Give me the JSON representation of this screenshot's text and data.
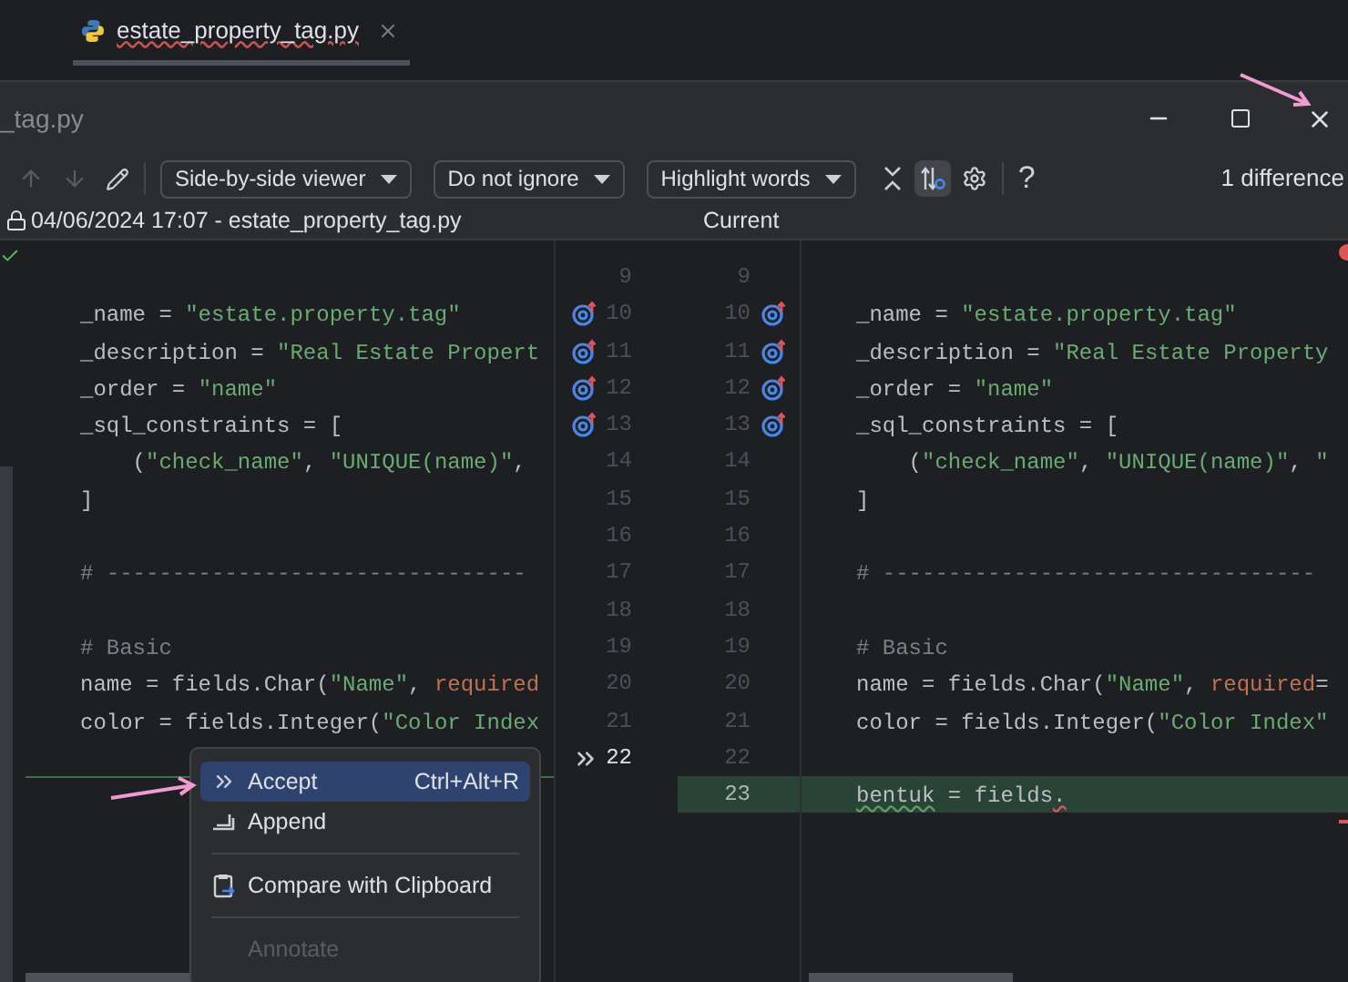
{
  "editor_tab": {
    "title": "estate_property_tag.py"
  },
  "dialog": {
    "title": "_tag.py"
  },
  "toolbar": {
    "dropdowns": [
      "Side-by-side viewer",
      "Do not ignore",
      "Highlight words"
    ],
    "sync_scroll": {
      "selected": true
    },
    "help": "?",
    "differences": "1 difference"
  },
  "left_pane": {
    "header": "04/06/2024 17:07 - estate_property_tag.py",
    "lines": [
      {
        "number": "9",
        "kind": "plain"
      },
      {
        "number": "10",
        "kind": "override",
        "code": [
          {
            "kind": "plain",
            "text": "_name = "
          },
          {
            "kind": "string",
            "text": "\"estate.property.tag\""
          }
        ]
      },
      {
        "number": "11",
        "kind": "override",
        "code": [
          {
            "kind": "plain",
            "text": "_description = "
          },
          {
            "kind": "string",
            "text": "\"Real Estate Propert"
          }
        ]
      },
      {
        "number": "12",
        "kind": "override",
        "code": [
          {
            "kind": "plain",
            "text": "_order = "
          },
          {
            "kind": "string",
            "text": "\"name\""
          }
        ]
      },
      {
        "number": "13",
        "kind": "override",
        "code": [
          {
            "kind": "plain",
            "text": "_sql_constraints = ["
          }
        ]
      },
      {
        "number": "14",
        "kind": "plain",
        "code": [
          {
            "kind": "plain",
            "text": "    ("
          },
          {
            "kind": "string",
            "text": "\"check_name\""
          },
          {
            "kind": "plain",
            "text": ", "
          },
          {
            "kind": "string",
            "text": "\"UNIQUE(name)\""
          },
          {
            "kind": "plain",
            "text": ","
          }
        ]
      },
      {
        "number": "15",
        "kind": "plain",
        "code": [
          {
            "kind": "plain",
            "text": "]"
          }
        ]
      },
      {
        "number": "16",
        "kind": "plain"
      },
      {
        "number": "17",
        "kind": "plain",
        "code": [
          {
            "kind": "comment",
            "text": "# --------------------------------"
          }
        ]
      },
      {
        "number": "18",
        "kind": "plain"
      },
      {
        "number": "19",
        "kind": "plain",
        "code": [
          {
            "kind": "comment",
            "text": "# Basic"
          }
        ]
      },
      {
        "number": "20",
        "kind": "plain",
        "code": [
          {
            "kind": "plain",
            "text": "name = fields.Char("
          },
          {
            "kind": "string",
            "text": "\"Name\""
          },
          {
            "kind": "plain",
            "text": ", "
          },
          {
            "kind": "keyword_arg",
            "text": "required"
          }
        ]
      },
      {
        "number": "21",
        "kind": "plain",
        "code": [
          {
            "kind": "plain",
            "text": "color = fields.Integer("
          },
          {
            "kind": "string",
            "text": "\"Color Index"
          }
        ]
      },
      {
        "number": "22",
        "kind": "accept"
      }
    ]
  },
  "right_pane": {
    "header": "Current",
    "lines": [
      {
        "number": "9",
        "kind": "plain",
        "added": false
      },
      {
        "number": "10",
        "kind": "override",
        "added": false,
        "code": [
          {
            "kind": "plain",
            "text": "_name = "
          },
          {
            "kind": "string",
            "text": "\"estate.property.tag\""
          }
        ]
      },
      {
        "number": "11",
        "kind": "override",
        "added": false,
        "code": [
          {
            "kind": "plain",
            "text": "_description = "
          },
          {
            "kind": "string",
            "text": "\"Real Estate Property"
          }
        ]
      },
      {
        "number": "12",
        "kind": "override",
        "added": false,
        "code": [
          {
            "kind": "plain",
            "text": "_order = "
          },
          {
            "kind": "string",
            "text": "\"name\""
          }
        ]
      },
      {
        "number": "13",
        "kind": "override",
        "added": false,
        "code": [
          {
            "kind": "plain",
            "text": "_sql_constraints = ["
          }
        ]
      },
      {
        "number": "14",
        "kind": "plain",
        "added": false,
        "code": [
          {
            "kind": "plain",
            "text": "    ("
          },
          {
            "kind": "string",
            "text": "\"check_name\""
          },
          {
            "kind": "plain",
            "text": ", "
          },
          {
            "kind": "string",
            "text": "\"UNIQUE(name)\""
          },
          {
            "kind": "plain",
            "text": ", "
          },
          {
            "kind": "string",
            "text": "\""
          }
        ]
      },
      {
        "number": "15",
        "kind": "plain",
        "added": false,
        "code": [
          {
            "kind": "plain",
            "text": "]"
          }
        ]
      },
      {
        "number": "16",
        "kind": "plain",
        "added": false
      },
      {
        "number": "17",
        "kind": "plain",
        "added": false,
        "code": [
          {
            "kind": "comment",
            "text": "# ---------------------------------"
          }
        ]
      },
      {
        "number": "18",
        "kind": "plain",
        "added": false
      },
      {
        "number": "19",
        "kind": "plain",
        "added": false,
        "code": [
          {
            "kind": "comment",
            "text": "# Basic"
          }
        ]
      },
      {
        "number": "20",
        "kind": "plain",
        "added": false,
        "code": [
          {
            "kind": "plain",
            "text": "name = fields.Char("
          },
          {
            "kind": "string",
            "text": "\"Name\""
          },
          {
            "kind": "plain",
            "text": ", "
          },
          {
            "kind": "keyword_arg",
            "text": "required"
          },
          {
            "kind": "plain",
            "text": "="
          }
        ]
      },
      {
        "number": "21",
        "kind": "plain",
        "added": false,
        "code": [
          {
            "kind": "plain",
            "text": "color = fields.Integer("
          },
          {
            "kind": "string",
            "text": "\"Color Index\""
          }
        ]
      },
      {
        "number": "22",
        "kind": "plain",
        "added": false
      },
      {
        "number": "23",
        "kind": "plain",
        "added": true,
        "code": [
          {
            "kind": "warning",
            "text": "bentuk"
          },
          {
            "kind": "plain",
            "text": " = fields"
          },
          {
            "kind": "error",
            "text": "."
          }
        ]
      }
    ]
  },
  "context_menu": {
    "items": [
      {
        "kind": "item",
        "label": "Accept",
        "shortcut": "Ctrl+Alt+R",
        "selected": true,
        "disabled": false
      },
      {
        "kind": "item",
        "label": "Append",
        "selected": false,
        "disabled": false
      },
      {
        "kind": "separator"
      },
      {
        "kind": "item",
        "label": "Compare with Clipboard",
        "selected": false,
        "disabled": false
      },
      {
        "kind": "separator"
      },
      {
        "kind": "item",
        "label": "Annotate",
        "selected": false,
        "disabled": true
      }
    ]
  }
}
